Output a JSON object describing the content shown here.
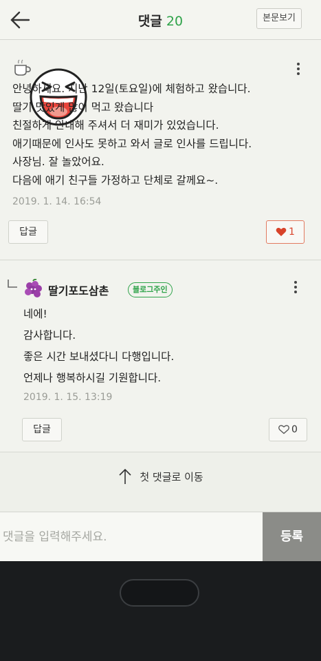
{
  "header": {
    "title": "댓글",
    "count": "20",
    "view_post_label": "본문보기"
  },
  "comments": [
    {
      "lines": [
        "안녕하세요. 지난 12일(토요일)에 체험하고 왔습니다.",
        "딸기 맛있게 많이 먹고 왔습니다",
        "친절하게 안내해 주셔서 더 재미가 있었습니다.",
        "애기때문에 인사도 못하고 와서 글로 인사를 드립니다.",
        "사장님. 잘 놀았어요.",
        "다음에 애기 친구들 가정하고 단체로 갈께요~."
      ],
      "date": "2019. 1. 14. 16:54",
      "reply_label": "답글",
      "like_count": "1",
      "liked": true
    },
    {
      "author": "딸기포도삼촌",
      "badge": "블로그주인",
      "lines": [
        "네에!",
        "감사합니다.",
        "좋은 시간 보내셨다니 다행입니다.",
        "언제나 행복하시길 기원합니다."
      ],
      "date": "2019. 1. 15. 13:19",
      "reply_label": "답글",
      "like_count": "0",
      "liked": false
    }
  ],
  "goto_first_label": "첫 댓글로 이동",
  "input": {
    "placeholder": "댓글을 입력해주세요.",
    "submit_label": "등록"
  },
  "colors": {
    "accent_green": "#2fa34a",
    "like_red": "#d8432a",
    "submit_bg": "#8b8c88"
  },
  "icons": [
    "back-arrow-icon",
    "coffee-cup-icon",
    "laughing-face-icon",
    "more-vertical-icon",
    "heart-icon",
    "reply-arrow-icon",
    "grape-avatar-icon",
    "arrow-up-icon"
  ]
}
